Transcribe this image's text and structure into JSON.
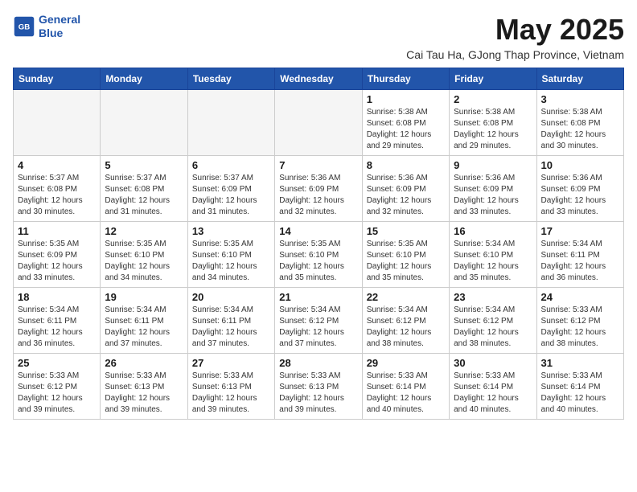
{
  "logo": {
    "line1": "General",
    "line2": "Blue"
  },
  "title": "May 2025",
  "subtitle": "Cai Tau Ha, GJong Thap Province, Vietnam",
  "headers": [
    "Sunday",
    "Monday",
    "Tuesday",
    "Wednesday",
    "Thursday",
    "Friday",
    "Saturday"
  ],
  "weeks": [
    [
      {
        "day": "",
        "info": ""
      },
      {
        "day": "",
        "info": ""
      },
      {
        "day": "",
        "info": ""
      },
      {
        "day": "",
        "info": ""
      },
      {
        "day": "1",
        "info": "Sunrise: 5:38 AM\nSunset: 6:08 PM\nDaylight: 12 hours\nand 29 minutes."
      },
      {
        "day": "2",
        "info": "Sunrise: 5:38 AM\nSunset: 6:08 PM\nDaylight: 12 hours\nand 29 minutes."
      },
      {
        "day": "3",
        "info": "Sunrise: 5:38 AM\nSunset: 6:08 PM\nDaylight: 12 hours\nand 30 minutes."
      }
    ],
    [
      {
        "day": "4",
        "info": "Sunrise: 5:37 AM\nSunset: 6:08 PM\nDaylight: 12 hours\nand 30 minutes."
      },
      {
        "day": "5",
        "info": "Sunrise: 5:37 AM\nSunset: 6:08 PM\nDaylight: 12 hours\nand 31 minutes."
      },
      {
        "day": "6",
        "info": "Sunrise: 5:37 AM\nSunset: 6:09 PM\nDaylight: 12 hours\nand 31 minutes."
      },
      {
        "day": "7",
        "info": "Sunrise: 5:36 AM\nSunset: 6:09 PM\nDaylight: 12 hours\nand 32 minutes."
      },
      {
        "day": "8",
        "info": "Sunrise: 5:36 AM\nSunset: 6:09 PM\nDaylight: 12 hours\nand 32 minutes."
      },
      {
        "day": "9",
        "info": "Sunrise: 5:36 AM\nSunset: 6:09 PM\nDaylight: 12 hours\nand 33 minutes."
      },
      {
        "day": "10",
        "info": "Sunrise: 5:36 AM\nSunset: 6:09 PM\nDaylight: 12 hours\nand 33 minutes."
      }
    ],
    [
      {
        "day": "11",
        "info": "Sunrise: 5:35 AM\nSunset: 6:09 PM\nDaylight: 12 hours\nand 33 minutes."
      },
      {
        "day": "12",
        "info": "Sunrise: 5:35 AM\nSunset: 6:10 PM\nDaylight: 12 hours\nand 34 minutes."
      },
      {
        "day": "13",
        "info": "Sunrise: 5:35 AM\nSunset: 6:10 PM\nDaylight: 12 hours\nand 34 minutes."
      },
      {
        "day": "14",
        "info": "Sunrise: 5:35 AM\nSunset: 6:10 PM\nDaylight: 12 hours\nand 35 minutes."
      },
      {
        "day": "15",
        "info": "Sunrise: 5:35 AM\nSunset: 6:10 PM\nDaylight: 12 hours\nand 35 minutes."
      },
      {
        "day": "16",
        "info": "Sunrise: 5:34 AM\nSunset: 6:10 PM\nDaylight: 12 hours\nand 35 minutes."
      },
      {
        "day": "17",
        "info": "Sunrise: 5:34 AM\nSunset: 6:11 PM\nDaylight: 12 hours\nand 36 minutes."
      }
    ],
    [
      {
        "day": "18",
        "info": "Sunrise: 5:34 AM\nSunset: 6:11 PM\nDaylight: 12 hours\nand 36 minutes."
      },
      {
        "day": "19",
        "info": "Sunrise: 5:34 AM\nSunset: 6:11 PM\nDaylight: 12 hours\nand 37 minutes."
      },
      {
        "day": "20",
        "info": "Sunrise: 5:34 AM\nSunset: 6:11 PM\nDaylight: 12 hours\nand 37 minutes."
      },
      {
        "day": "21",
        "info": "Sunrise: 5:34 AM\nSunset: 6:12 PM\nDaylight: 12 hours\nand 37 minutes."
      },
      {
        "day": "22",
        "info": "Sunrise: 5:34 AM\nSunset: 6:12 PM\nDaylight: 12 hours\nand 38 minutes."
      },
      {
        "day": "23",
        "info": "Sunrise: 5:34 AM\nSunset: 6:12 PM\nDaylight: 12 hours\nand 38 minutes."
      },
      {
        "day": "24",
        "info": "Sunrise: 5:33 AM\nSunset: 6:12 PM\nDaylight: 12 hours\nand 38 minutes."
      }
    ],
    [
      {
        "day": "25",
        "info": "Sunrise: 5:33 AM\nSunset: 6:12 PM\nDaylight: 12 hours\nand 39 minutes."
      },
      {
        "day": "26",
        "info": "Sunrise: 5:33 AM\nSunset: 6:13 PM\nDaylight: 12 hours\nand 39 minutes."
      },
      {
        "day": "27",
        "info": "Sunrise: 5:33 AM\nSunset: 6:13 PM\nDaylight: 12 hours\nand 39 minutes."
      },
      {
        "day": "28",
        "info": "Sunrise: 5:33 AM\nSunset: 6:13 PM\nDaylight: 12 hours\nand 39 minutes."
      },
      {
        "day": "29",
        "info": "Sunrise: 5:33 AM\nSunset: 6:14 PM\nDaylight: 12 hours\nand 40 minutes."
      },
      {
        "day": "30",
        "info": "Sunrise: 5:33 AM\nSunset: 6:14 PM\nDaylight: 12 hours\nand 40 minutes."
      },
      {
        "day": "31",
        "info": "Sunrise: 5:33 AM\nSunset: 6:14 PM\nDaylight: 12 hours\nand 40 minutes."
      }
    ]
  ]
}
